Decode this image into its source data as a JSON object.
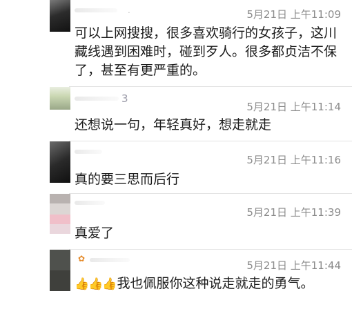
{
  "comments": [
    {
      "name": "　.",
      "time": "5月21日 上午11:09",
      "text": "可以上网搜搜，很多喜欢骑行的女孩子，这川藏线遇到困难时，碰到歹人。很多都贞洁不保了，甚至有更严重的。"
    },
    {
      "name": "3",
      "time": "5月21日 上午11:14",
      "text": "还想说一句，年轻真好，想走就走"
    },
    {
      "name": "",
      "time": "5月21日 上午11:16",
      "text": "真的要三思而后行"
    },
    {
      "name": "",
      "time": "5月21日 上午11:39",
      "text": "真爱了"
    },
    {
      "name": "",
      "time": "5月21日 上午11:44",
      "emoji": "👍👍👍",
      "text": "我也佩服你这种说走就走的勇气。"
    }
  ],
  "icons": {
    "thumbs": "thumbs-up-icon"
  }
}
